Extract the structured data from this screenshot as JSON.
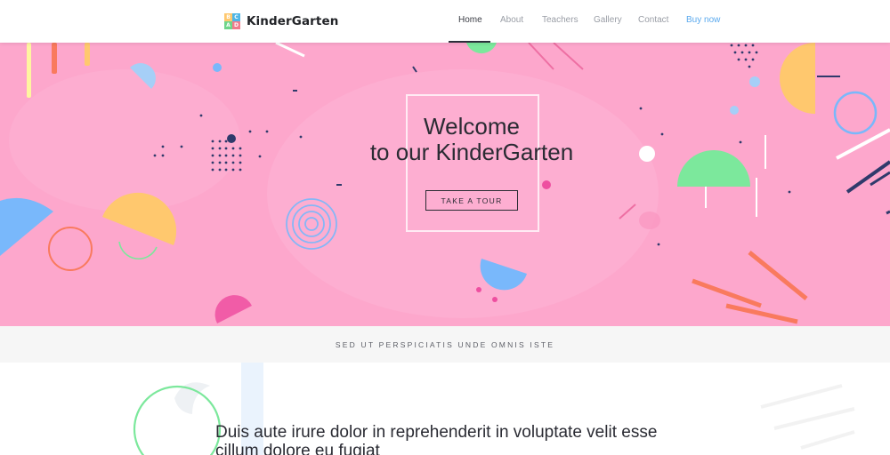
{
  "brand": {
    "name": "KinderGarten",
    "icon_name": "kindergarten-logo-icon",
    "icon_glyphs": [
      "B",
      "C",
      "A",
      "D"
    ]
  },
  "nav": {
    "items": [
      {
        "label": "Home",
        "active": true
      },
      {
        "label": "About",
        "active": false
      },
      {
        "label": "Teachers",
        "active": false
      },
      {
        "label": "Gallery",
        "active": false
      },
      {
        "label": "Contact",
        "active": false
      }
    ],
    "buy_label": "Buy now"
  },
  "hero": {
    "title_line1": "Welcome",
    "title_line2": "to our KinderGarten",
    "button_label": "TAKE A TOUR",
    "background_color": "#fda7cc"
  },
  "tagline": {
    "text": "SED UT PERSPICIATIS UNDE OMNIS ISTE"
  },
  "intro": {
    "text": "Duis aute irure dolor in reprehenderit in voluptate velit esse cillum dolore eu fugiat"
  },
  "colors": {
    "accent_blue": "#5aa9ee",
    "text_dark": "#2a2b33",
    "nav_muted": "#9a9ea6",
    "shape_yellow": "#ffc86e",
    "shape_green": "#7ce89c",
    "shape_blue": "#79b8fb",
    "shape_orange": "#f97a5e",
    "shape_navy": "#2f3a6b"
  }
}
